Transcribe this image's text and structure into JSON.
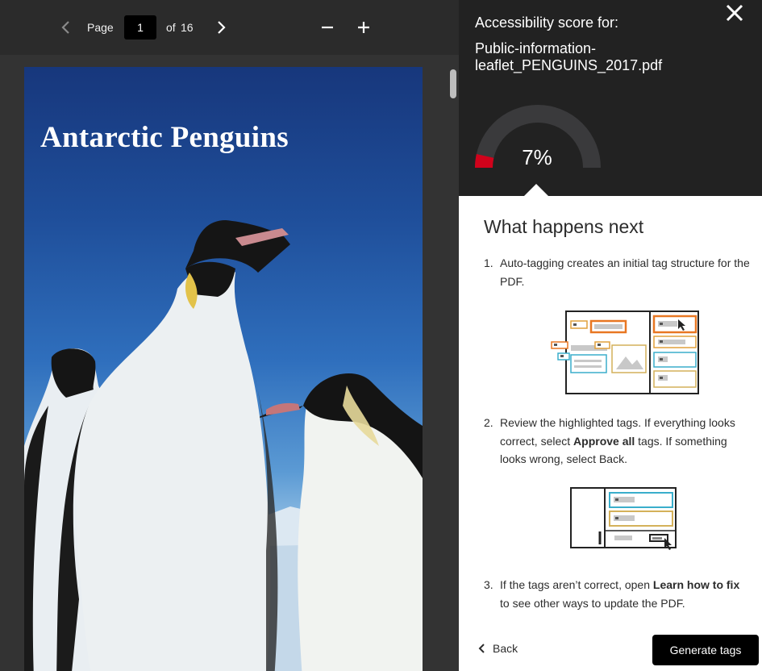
{
  "viewer": {
    "page_label": "Page",
    "current_page": "1",
    "of_label": "of",
    "total_pages": "16",
    "icons": {
      "prev": "chevron-left-icon",
      "next": "chevron-right-icon",
      "zoom_out": "minus-icon",
      "zoom_in": "plus-icon"
    }
  },
  "pdf": {
    "title": "Antarctic Penguins",
    "image": "emperor-penguins-photo"
  },
  "panel": {
    "score_label": "Accessibility score for:",
    "file_name": "Public-information-leaflet_PENGUINS_2017.pdf",
    "score": 0.07,
    "score_text": "7%",
    "colors": {
      "gauge_track": "#3a3a3c",
      "gauge_fill": "#d0021b",
      "header_bg": "#222222"
    },
    "close_icon": "close-icon",
    "next_title": "What happens next",
    "steps": [
      {
        "num": "1.",
        "text": "Auto-tagging creates an initial tag structure for the PDF."
      },
      {
        "num": "2.",
        "text_a": "Review the highlighted tags. If everything looks correct, select ",
        "bold": "Approve all",
        "text_b": " tags. If something looks wrong, select Back."
      },
      {
        "num": "3.",
        "text_a": "If the tags aren’t correct, open ",
        "bold": "Learn how to fix",
        "text_b": " to see other ways to update the PDF."
      }
    ],
    "back_label": "Back",
    "generate_label": "Generate tags"
  }
}
